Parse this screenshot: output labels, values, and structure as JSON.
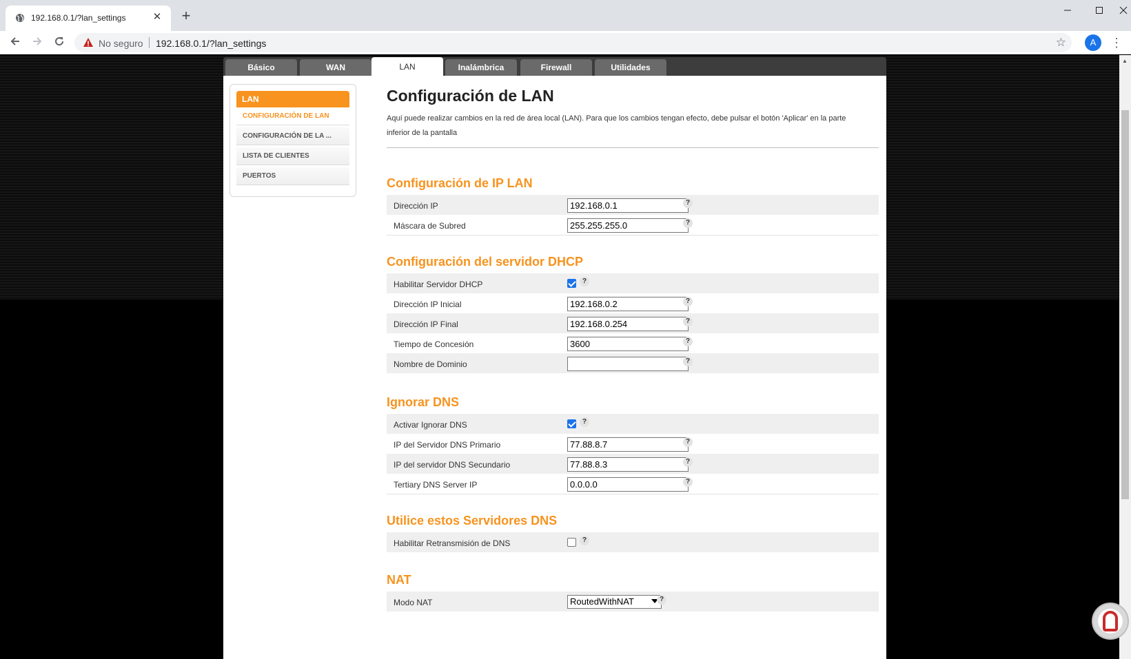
{
  "browser": {
    "tab_title": "192.168.0.1/?lan_settings",
    "tab_close": "✕",
    "new_tab": "+",
    "insecure_label": "No seguro",
    "url": "192.168.0.1/?lan_settings",
    "avatar_letter": "A",
    "icons": [
      "globe-icon",
      "close-icon",
      "plus-icon",
      "minimize-icon",
      "maximize-icon",
      "window-close-icon",
      "back-icon",
      "forward-icon",
      "reload-icon",
      "warning-icon",
      "star-icon",
      "kebab-menu-icon"
    ]
  },
  "main_tabs": [
    {
      "label": "Básico",
      "active": false
    },
    {
      "label": "WAN",
      "active": false
    },
    {
      "label": "LAN",
      "active": true
    },
    {
      "label": "Inalámbrica",
      "active": false
    },
    {
      "label": "Firewall",
      "active": false
    },
    {
      "label": "Utilidades",
      "active": false
    }
  ],
  "sidebar": {
    "header": "LAN",
    "items": [
      {
        "label": "CONFIGURACIÓN DE LAN",
        "active": true
      },
      {
        "label": "CONFIGURACIÓN DE LA ...",
        "active": false
      },
      {
        "label": "LISTA DE CLIENTES",
        "active": false
      },
      {
        "label": "PUERTOS",
        "active": false
      }
    ]
  },
  "page": {
    "title": "Configuración de LAN",
    "description": "Aquí puede realizar cambios en la red de área local (LAN). Para que los cambios tengan efecto, debe pulsar el botón 'Aplicar' en la parte inferior de la pantalla"
  },
  "help_glyph": "?",
  "sections": {
    "ip_lan": {
      "title": "Configuración de IP LAN",
      "ip_address": {
        "label": "Dirección IP",
        "value": "192.168.0.1"
      },
      "subnet_mask": {
        "label": "Máscara de Subred",
        "value": "255.255.255.0"
      }
    },
    "dhcp": {
      "title": "Configuración del servidor DHCP",
      "enable": {
        "label": "Habilitar Servidor DHCP",
        "checked": true
      },
      "start_ip": {
        "label": "Dirección IP Inicial",
        "value": "192.168.0.2"
      },
      "end_ip": {
        "label": "Dirección IP Final",
        "value": "192.168.0.254"
      },
      "lease_time": {
        "label": "Tiempo de Concesión",
        "value": "3600"
      },
      "domain_name": {
        "label": "Nombre de Dominio",
        "value": ""
      }
    },
    "dns_override": {
      "title": "Ignorar DNS",
      "enable": {
        "label": "Activar Ignorar DNS",
        "checked": true
      },
      "primary": {
        "label": "IP del Servidor DNS Primario",
        "value": "77.88.8.7"
      },
      "secondary": {
        "label": "IP del servidor DNS Secundario",
        "value": "77.88.8.3"
      },
      "tertiary": {
        "label": "Tertiary DNS Server IP",
        "value": "0.0.0.0"
      }
    },
    "dns_relay": {
      "title": "Utilice estos Servidores DNS",
      "enable": {
        "label": "Habilitar Retransmisión de DNS",
        "checked": false
      }
    },
    "nat": {
      "title": "NAT",
      "mode": {
        "label": "Modo NAT",
        "selected": "RoutedWithNAT"
      }
    }
  },
  "colors": {
    "accent": "#f7931e",
    "tab_bg": "#6a6a6a",
    "row_alt": "#efefef"
  }
}
